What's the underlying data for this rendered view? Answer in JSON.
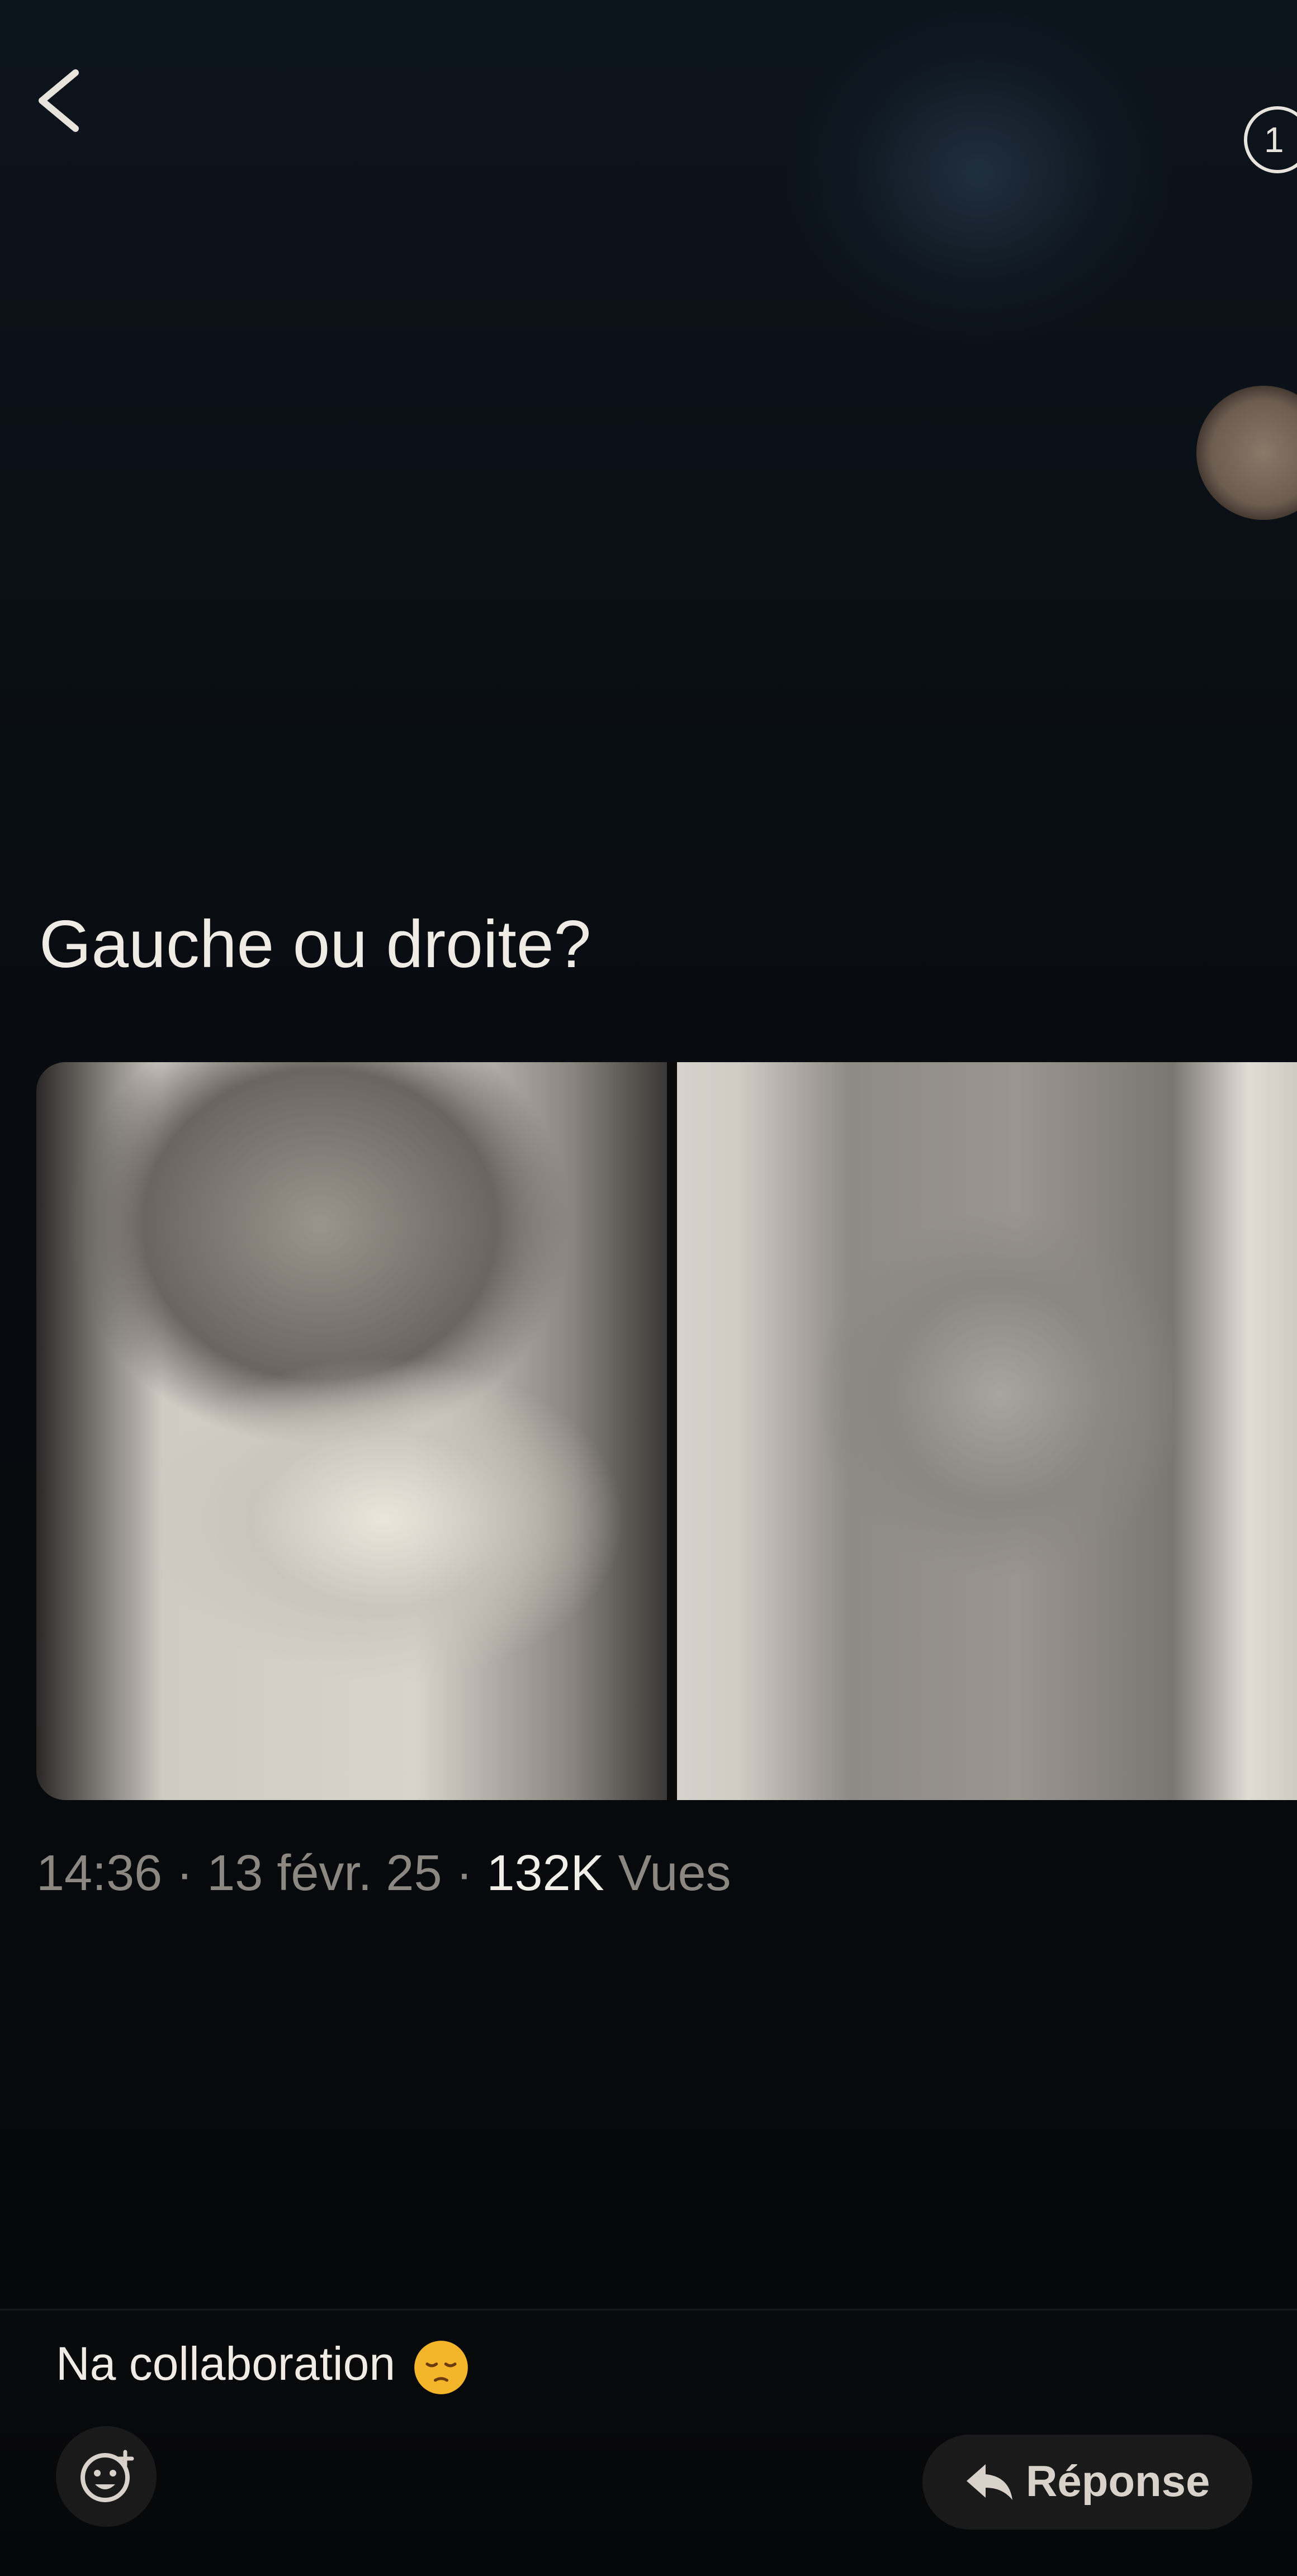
{
  "header": {
    "back_icon": "chevron-left-icon",
    "count_badge": "1"
  },
  "post": {
    "text": "Gauche ou droite?",
    "images": [
      {
        "icon": "photo-left"
      },
      {
        "icon": "photo-right"
      }
    ],
    "time": "14:36",
    "separator_1": " · ",
    "date": "13 févr. 25",
    "separator_2": " · ",
    "views_count": "132K",
    "views_label": " Vues"
  },
  "reply": {
    "text": "Na collaboration",
    "emoji_icon": "pensive-face-icon",
    "emoji_button_icon": "add-reaction-icon",
    "reply_label": "Réponse",
    "reply_icon": "reply-arrow-icon"
  },
  "colors": {
    "background": "#07090c",
    "text": "#f0ebe4",
    "muted": "#8c8780"
  }
}
